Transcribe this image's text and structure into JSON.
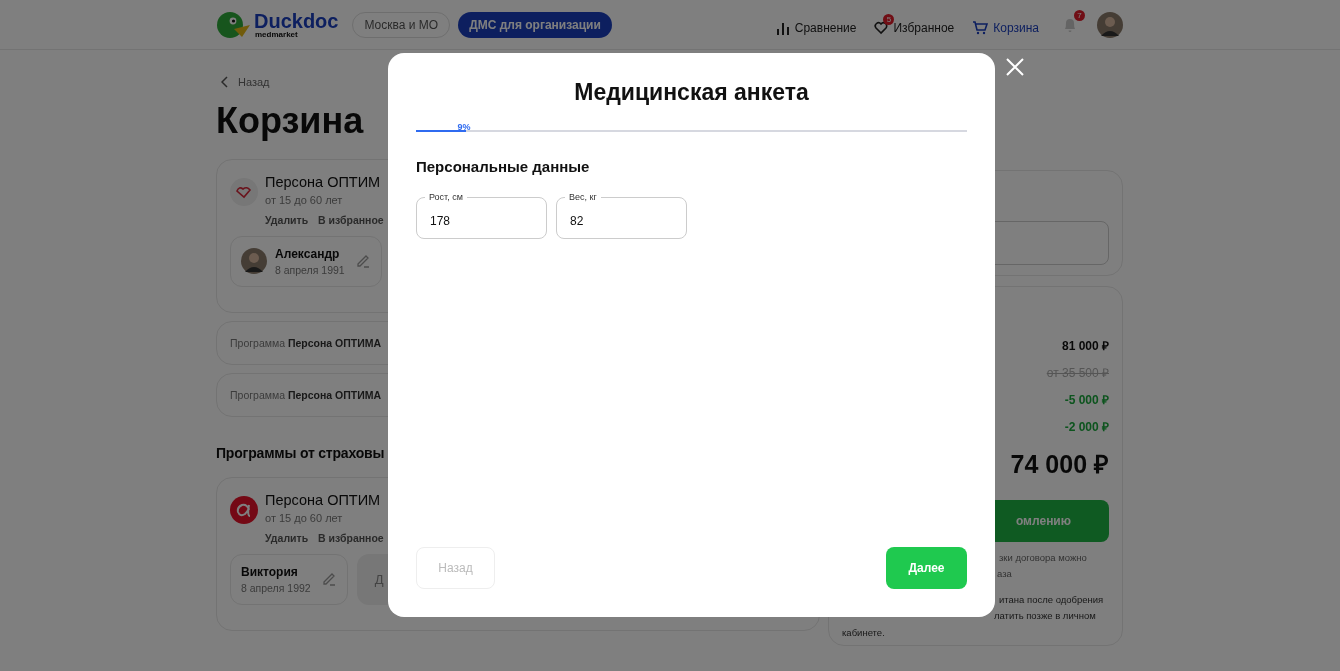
{
  "header": {
    "logo": {
      "name": "Duckdoc",
      "sub": "medmarket"
    },
    "region": "Москва и МО",
    "cta": "ДМС для организации",
    "nav": [
      {
        "kind": "compare",
        "label": "Сравнение",
        "selected": false
      },
      {
        "kind": "favorites",
        "label": "Избранное",
        "badge": "5",
        "selected": false
      },
      {
        "kind": "cart",
        "label": "Корзина",
        "selected": true
      }
    ],
    "notifications": {
      "badge": "7"
    }
  },
  "page": {
    "back": "Назад",
    "title": "Корзина",
    "cart_card": {
      "title": "Персона ОПТИМ",
      "age": "от 15 до 60 лет",
      "actions": [
        "Удалить",
        "В избранное"
      ],
      "people": [
        {
          "kind": "photo_person",
          "name": "Александр",
          "date": "8 апреля 1991"
        }
      ]
    },
    "program_rows": [
      "Программа **Персона ОПТИМА**",
      "Программа **Персона ОПТИМА**"
    ],
    "section_title": "Программы от страховы",
    "insurer_card": {
      "title": "Персона ОПТИМ",
      "age": "от 15 до 60 лет",
      "actions": [
        "Удалить",
        "В избранное"
      ],
      "people": [
        {
          "kind": "person",
          "name": "Виктория",
          "date": "8 апреля 1992"
        },
        {
          "kind": "add",
          "label": "Д"
        }
      ]
    }
  },
  "summary": {
    "prices": [
      {
        "kind": "plain",
        "value": "81 000 ₽"
      },
      {
        "kind": "old",
        "value": "от 35 500 ₽"
      },
      {
        "kind": "discount",
        "value": "-5 000 ₽"
      },
      {
        "kind": "discount",
        "value": "-2 000 ₽"
      }
    ],
    "total": "74 000 ₽",
    "checkout": "омлению",
    "notes": [
      [
        "зки договора можно",
        "аза"
      ],
      [
        "итана после одобрения",
        "латить позже в личном",
        "кабинете."
      ]
    ]
  },
  "modal": {
    "title": "Медицинская анкета",
    "progress": {
      "level": 0.09,
      "label": "9%"
    },
    "section": "Персональные данные",
    "fields": [
      {
        "label": "Рост, см",
        "value": "178"
      },
      {
        "label": "Вес, кг",
        "value": "82"
      }
    ],
    "back": {
      "label": "Назад",
      "disabled": true
    },
    "next": {
      "label": "Далее",
      "disabled": false
    }
  }
}
